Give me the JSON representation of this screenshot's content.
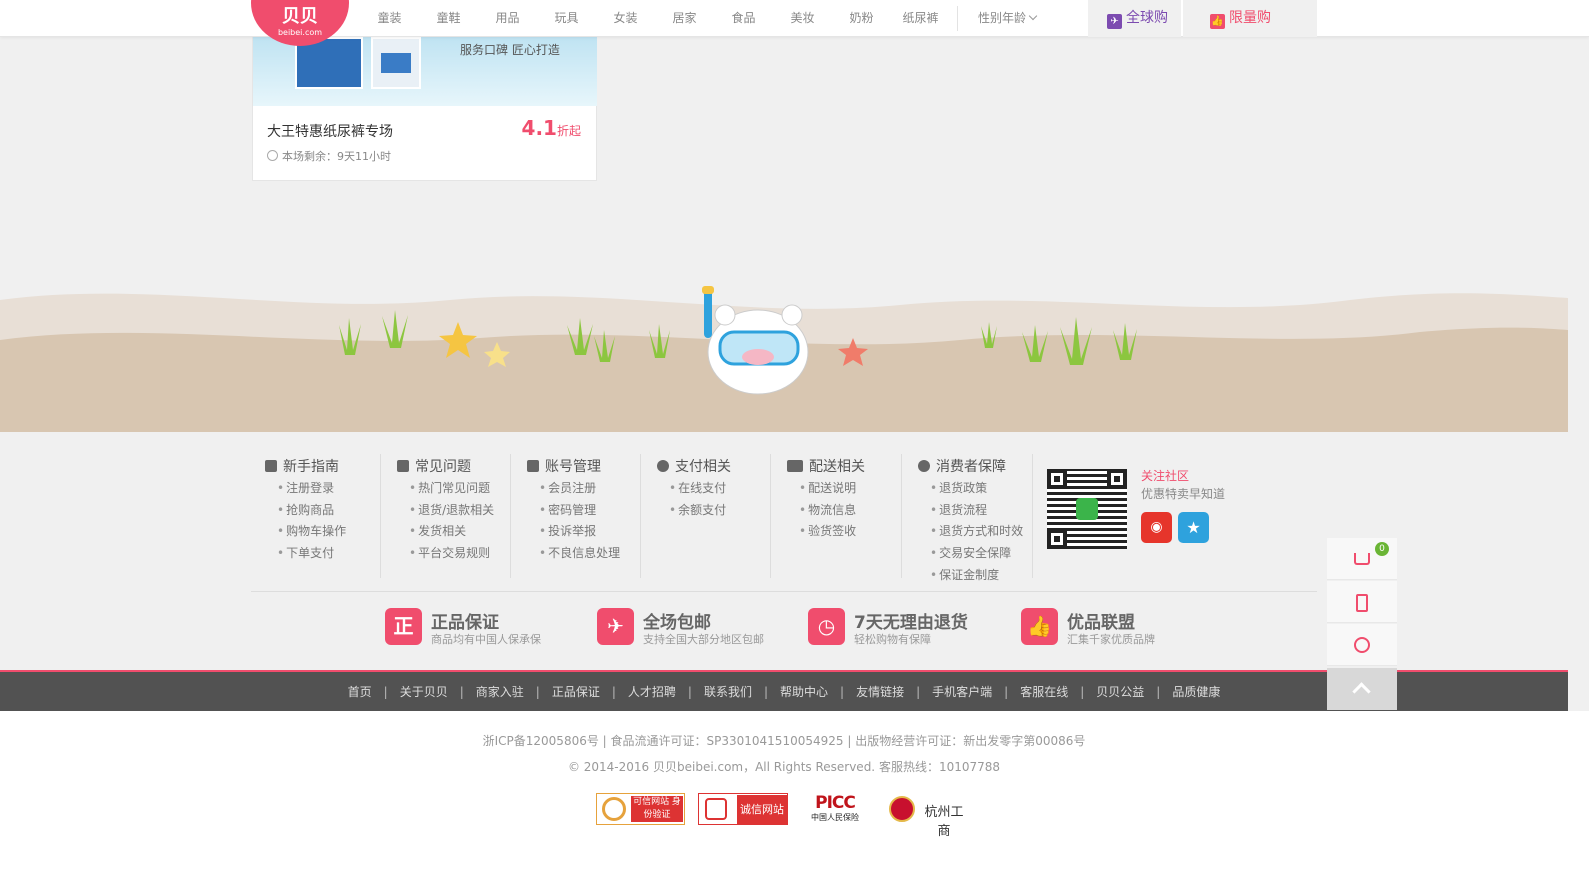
{
  "logo": {
    "main": "贝贝",
    "sub": "beibei.com"
  },
  "nav": {
    "items": [
      "童装",
      "童鞋",
      "用品",
      "玩具",
      "女装",
      "居家",
      "食品",
      "美妆",
      "奶粉",
      "纸尿裤"
    ],
    "gender_age": "性别年龄",
    "global_tab": "全球购",
    "limit_tab": "限量购"
  },
  "card": {
    "slogan": "服务口碑 匠心打造",
    "title": "大王特惠纸尿裤专场",
    "discount": "4.1",
    "discount_unit": "折起",
    "remaining": "本场剩余：9天11小时"
  },
  "help": {
    "columns": [
      {
        "title": "新手指南",
        "links": [
          "注册登录",
          "抢购商品",
          "购物车操作",
          "下单支付"
        ]
      },
      {
        "title": "常见问题",
        "links": [
          "热门常见问题",
          "退货/退款相关",
          "发货相关",
          "平台交易规则"
        ]
      },
      {
        "title": "账号管理",
        "links": [
          "会员注册",
          "密码管理",
          "投诉举报",
          "不良信息处理"
        ]
      },
      {
        "title": "支付相关",
        "links": [
          "在线支付",
          "余额支付"
        ]
      },
      {
        "title": "配送相关",
        "links": [
          "配送说明",
          "物流信息",
          "验货签收"
        ]
      },
      {
        "title": "消费者保障",
        "links": [
          "退货政策",
          "退货流程",
          "退货方式和时效",
          "交易安全保障",
          "保证金制度"
        ]
      }
    ],
    "follow_title": "关注社区",
    "follow_sub": "优惠特卖早知道"
  },
  "guarantees": [
    {
      "icon": "正",
      "title": "正品保证",
      "sub": "商品均有中国人保承保"
    },
    {
      "icon": "✈",
      "title": "全场包邮",
      "sub": "支持全国大部分地区包邮"
    },
    {
      "icon": "◷",
      "title": "7天无理由退货",
      "sub": "轻松购物有保障"
    },
    {
      "icon": "👍",
      "title": "优品联盟",
      "sub": "汇集千家优质品牌"
    }
  ],
  "footer_links": [
    "首页",
    "关于贝贝",
    "商家入驻",
    "正品保证",
    "人才招聘",
    "联系我们",
    "帮助中心",
    "友情链接",
    "手机客户端",
    "客服在线",
    "贝贝公益",
    "品质健康"
  ],
  "legal": {
    "icp": "浙ICP备12005806号 | 食品流通许可证：SP3301041510054925 | 出版物经营许可证：新出发零字第00086号",
    "copyright": "© 2014-2016 贝贝beibei.com，All Rights Reserved. 客服热线：10107788"
  },
  "badges": {
    "b1": "可信网站 身份验证",
    "b2": "诚信网站",
    "b3_big": "PICC",
    "b3_small": "中国人民保险",
    "b4": "杭州工商"
  },
  "sidebar": {
    "cart_count": "0"
  },
  "colors": {
    "brand": "#f04d6d",
    "global": "#7c4bb0",
    "footer_bar": "#525252"
  }
}
